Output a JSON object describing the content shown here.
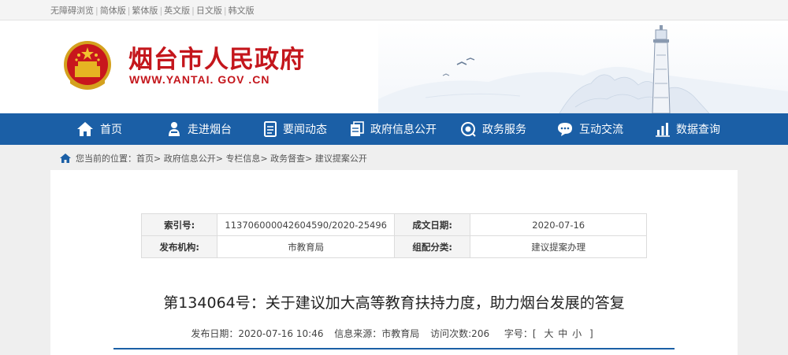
{
  "toplinks": [
    "无障碍浏览",
    "简体版",
    "繁体版",
    "英文版",
    "日文版",
    "韩文版"
  ],
  "site": {
    "title": "烟台市人民政府",
    "url": "WWW.YANTAI. GOV .CN"
  },
  "nav": [
    {
      "label": "首页",
      "icon": "home-icon"
    },
    {
      "label": "走进烟台",
      "icon": "person-icon"
    },
    {
      "label": "要闻动态",
      "icon": "document-icon"
    },
    {
      "label": "政府信息公开",
      "icon": "file-stack-icon"
    },
    {
      "label": "政务服务",
      "icon": "target-icon"
    },
    {
      "label": "互动交流",
      "icon": "chat-icon"
    },
    {
      "label": "数据查询",
      "icon": "bar-chart-icon"
    }
  ],
  "breadcrumb": {
    "prefix": "您当前的位置：",
    "items": [
      "首页",
      "政府信息公开",
      "专栏信息",
      "政务督查",
      "建议提案公开"
    ],
    "separator": ">"
  },
  "meta": {
    "index_label": "索引号:",
    "index_value": "113706000042604590/2020-25496",
    "date_label": "成文日期:",
    "date_value": "2020-07-16",
    "org_label": "发布机构:",
    "org_value": "市教育局",
    "category_label": "组配分类:",
    "category_value": "建议提案办理"
  },
  "article": {
    "title": "第134064号：关于建议加大高等教育扶持力度，助力烟台发展的答复",
    "publish": "发布日期：2020-07-16 10:46",
    "source": "信息来源：市教育局",
    "visits": "访问次数:206",
    "fontsize_label": "字号：[",
    "fontsize_large": "大",
    "fontsize_medium": "中",
    "fontsize_small": "小",
    "fontsize_close": "]"
  },
  "colors": {
    "brand_red": "#c4161c",
    "nav_blue": "#1b5fa6"
  }
}
